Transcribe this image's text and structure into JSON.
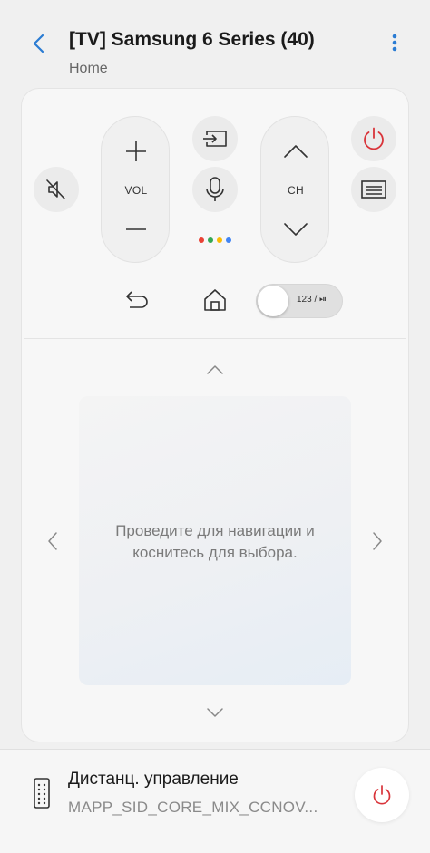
{
  "header": {
    "title": "[TV] Samsung 6 Series (40)",
    "subtitle": "Home",
    "back_icon": "chevron-left-icon",
    "more_icon": "vertical-dots-icon",
    "accent_color": "#2b7cd3"
  },
  "remote": {
    "volume": {
      "label": "VOL",
      "up_icon": "plus-icon",
      "down_icon": "minus-icon"
    },
    "channel": {
      "label": "CH",
      "up_icon": "chevron-up-icon",
      "down_icon": "chevron-down-icon"
    },
    "mute_icon": "mute-icon",
    "source_icon": "source-input-icon",
    "voice_icon": "microphone-icon",
    "power_icon": "power-icon",
    "guide_icon": "guide-icon",
    "back_icon": "return-icon",
    "home_icon": "home-icon",
    "assistant_dot_colors": [
      "#e94235",
      "#34a853",
      "#fabb05",
      "#4285f4"
    ],
    "power_color": "#d9343a",
    "toggle": {
      "label": "123 / ⏯",
      "on": false
    }
  },
  "touchpad": {
    "hint": "Проведите для навигации и коснитесь для выбора.",
    "nav_up_icon": "chevron-up-icon",
    "nav_down_icon": "chevron-down-icon",
    "nav_left_icon": "chevron-left-icon",
    "nav_right_icon": "chevron-right-icon"
  },
  "footer": {
    "title": "Дистанц. управление",
    "subtitle": "MAPP_SID_CORE_MIX_CCNOV...",
    "remote_icon": "remote-control-icon",
    "power_icon": "power-icon"
  }
}
